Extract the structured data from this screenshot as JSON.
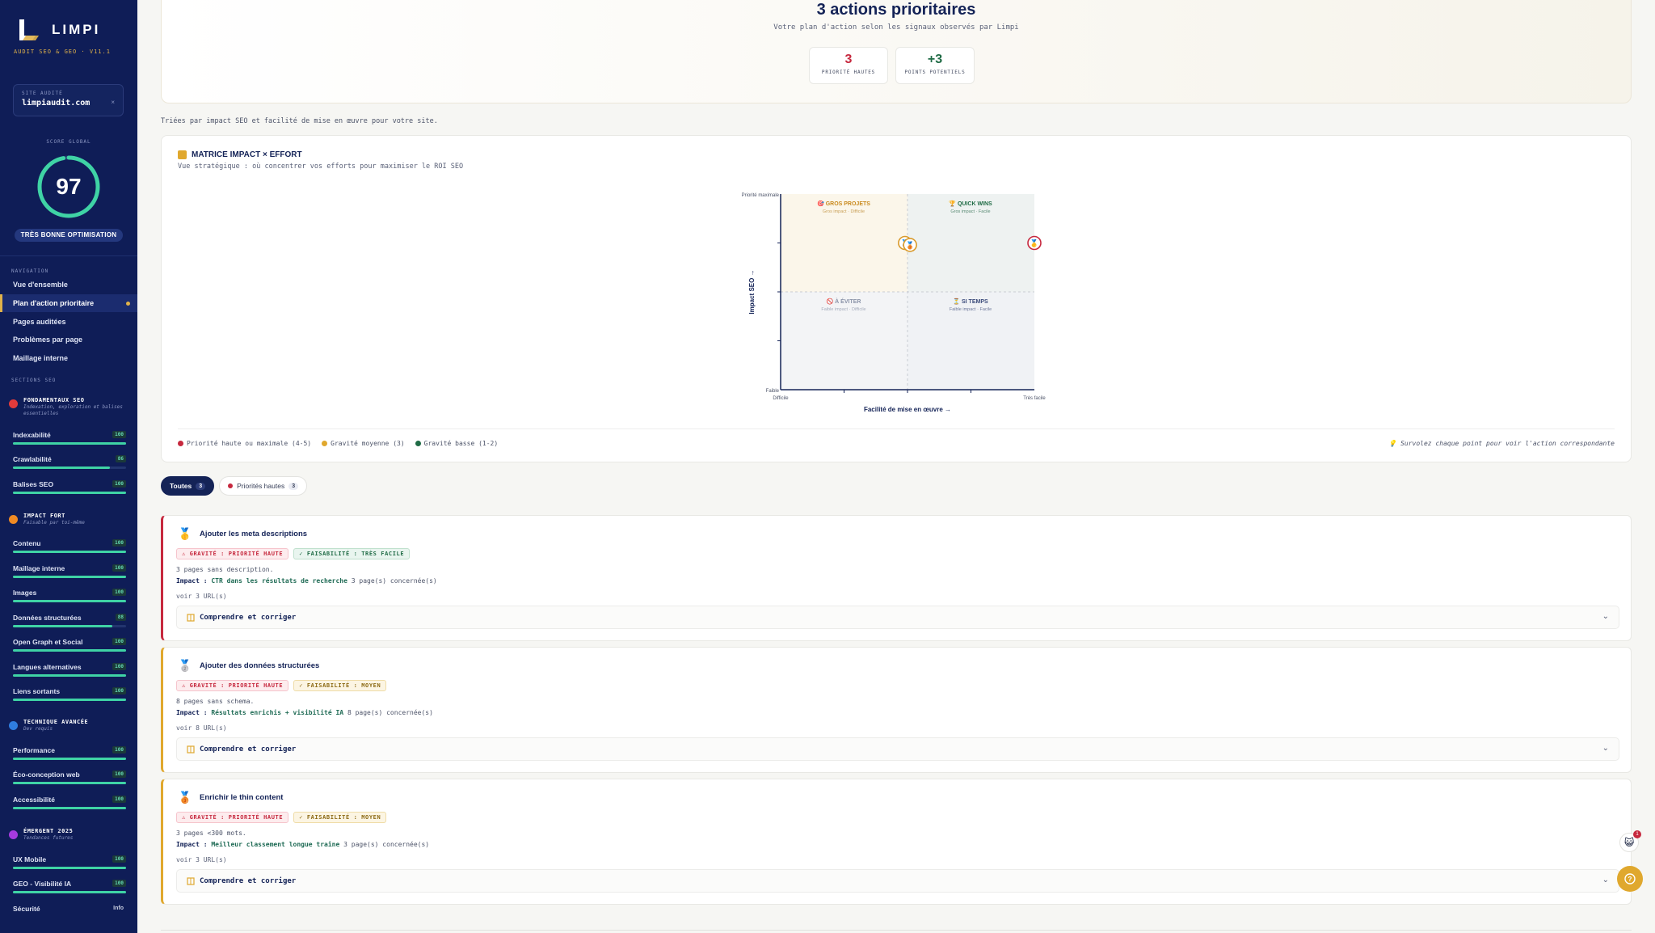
{
  "brand": {
    "name": "LIMPI",
    "tagline": "AUDIT SEO & GEO · V11.1"
  },
  "site": {
    "label": "SITE AUDITÉ",
    "value": "limpiaudit.com",
    "clear": "×"
  },
  "score": {
    "label": "SCORE GLOBAL",
    "value": "97",
    "percent": 97,
    "badge": "TRÈS BONNE OPTIMISATION"
  },
  "nav": {
    "heading": "NAVIGATION",
    "items": [
      "Vue d'ensemble",
      "Plan d'action prioritaire",
      "Pages auditées",
      "Problèmes par page",
      "Maillage interne"
    ]
  },
  "sections_heading": "SECTIONS SEO",
  "sections": [
    {
      "title": "FONDAMENTAUX SEO",
      "desc": "Indexation, exploration et balises essentielles",
      "color": "#e23b3b",
      "metrics": [
        {
          "name": "Indexabilité",
          "score": "100",
          "pct": 100
        },
        {
          "name": "Crawlabilité",
          "score": "86",
          "pct": 86
        },
        {
          "name": "Balises SEO",
          "score": "100",
          "pct": 100
        }
      ]
    },
    {
      "title": "IMPACT FORT",
      "desc": "Faisable par toi-même",
      "color": "#f08a24",
      "metrics": [
        {
          "name": "Contenu",
          "score": "100",
          "pct": 100
        },
        {
          "name": "Maillage interne",
          "score": "100",
          "pct": 100
        },
        {
          "name": "Images",
          "score": "100",
          "pct": 100
        },
        {
          "name": "Données structurées",
          "score": "88",
          "pct": 88
        },
        {
          "name": "Open Graph et Social",
          "score": "100",
          "pct": 100
        },
        {
          "name": "Langues alternatives",
          "score": "100",
          "pct": 100
        },
        {
          "name": "Liens sortants",
          "score": "100",
          "pct": 100
        }
      ]
    },
    {
      "title": "TECHNIQUE AVANCÉE",
      "desc": "Dev requis",
      "color": "#2f7de0",
      "metrics": [
        {
          "name": "Performance",
          "score": "100",
          "pct": 100
        },
        {
          "name": "Éco-conception web",
          "score": "100",
          "pct": 100
        },
        {
          "name": "Accessibilité",
          "score": "100",
          "pct": 100
        }
      ]
    },
    {
      "title": "ÉMERGENT 2025",
      "desc": "Tendances futures",
      "color": "#a63be0",
      "metrics": [
        {
          "name": "UX Mobile",
          "score": "100",
          "pct": 100
        },
        {
          "name": "GEO - Visibilité IA",
          "score": "100",
          "pct": 100
        },
        {
          "name": "Sécurité",
          "score": "Info",
          "pct": null
        }
      ]
    }
  ],
  "hero": {
    "title": "3 actions prioritaires",
    "subtitle": "Votre plan d'action selon les signaux observés par Limpi",
    "stats": [
      {
        "value": "+3",
        "label": "POINTS POTENTIELS",
        "color": "#1f6b45"
      }
    ],
    "high": {
      "value": "3",
      "label": "PRIORITÉ HAUTES",
      "color": "#c6283e"
    }
  },
  "sort_note": "Triées par impact SEO et facilité de mise en œuvre pour votre site.",
  "matrix": {
    "title": "MATRICE IMPACT × EFFORT",
    "subtitle": "Vue stratégique : où concentrer vos efforts pour maximiser le ROI SEO",
    "y_top": "Priorité maximale",
    "y_bottom": "Faible",
    "y_axis": "Impact SEO →",
    "x_left": "Difficile",
    "x_right": "Très facile",
    "x_axis": "Facilité de mise en œuvre →",
    "quadrants": [
      {
        "title": "🎯 GROS PROJETS",
        "sub": "Gros impact · Difficile",
        "color": "#c98a1e"
      },
      {
        "title": "🏆 QUICK WINS",
        "sub": "Gros impact · Facile",
        "color": "#1f6b45"
      },
      {
        "title": "🚫 À ÉVITER",
        "sub": "Faible impact · Difficile",
        "color": "#8a93a8"
      },
      {
        "title": "⏳ SI TEMPS",
        "sub": "Faible impact · Facile",
        "color": "#3a4a7a"
      }
    ],
    "points": [
      {
        "medal": "🥈",
        "ease": 0.49,
        "impact": 0.75
      },
      {
        "medal": "🥉",
        "ease": 0.51,
        "impact": 0.74
      },
      {
        "medal": "🥇",
        "ease": 1.0,
        "impact": 0.75
      }
    ],
    "legend": [
      {
        "label": "Priorité haute ou maximale (4-5)",
        "color": "#c6283e"
      },
      {
        "label": "Gravité moyenne (3)",
        "color": "#e0a82e"
      },
      {
        "label": "Gravité basse (1-2)",
        "color": "#1f6b45"
      }
    ],
    "hint": "Survolez chaque point pour voir l'action correspondante",
    "hint_icon": "💡"
  },
  "filters": [
    {
      "label": "Toutes",
      "count": "3"
    },
    {
      "label": "Priorités hautes",
      "count": "3"
    }
  ],
  "actions": [
    {
      "medal": "🥇",
      "title": "Ajouter les meta descriptions",
      "border": "#c6283e",
      "gravity": "GRAVITÉ : PRIORITÉ HAUTE",
      "feas": "FAISABILITÉ : TRÈS FACILE",
      "feas_style": "green",
      "detail": "3 pages sans description.",
      "impact_label": "Impact :",
      "impact": "CTR dans les résultats de recherche",
      "pages": "3 page(s) concernée(s)",
      "see": "voir 3 URL(s)",
      "expand": "Comprendre et corriger"
    },
    {
      "medal": "🥈",
      "title": "Ajouter des données structurées",
      "border": "#e0a82e",
      "gravity": "GRAVITÉ : PRIORITÉ HAUTE",
      "feas": "FAISABILITÉ : MOYEN",
      "feas_style": "yellow",
      "detail": "8 pages sans schema.",
      "impact_label": "Impact :",
      "impact": "Résultats enrichis + visibilité IA",
      "pages": "8 page(s) concernée(s)",
      "see": "voir 8 URL(s)",
      "expand": "Comprendre et corriger"
    },
    {
      "medal": "🥉",
      "title": "Enrichir le thin content",
      "border": "#e0a82e",
      "gravity": "GRAVITÉ : PRIORITÉ HAUTE",
      "feas": "FAISABILITÉ : MOYEN",
      "feas_style": "yellow",
      "detail": "3 pages <300 mots.",
      "impact_label": "Impact :",
      "impact": "Meilleur classement longue traîne",
      "pages": "3 page(s) concernée(s)",
      "see": "voir 3 URL(s)",
      "expand": "Comprendre et corriger"
    }
  ],
  "chat_badge": "1"
}
